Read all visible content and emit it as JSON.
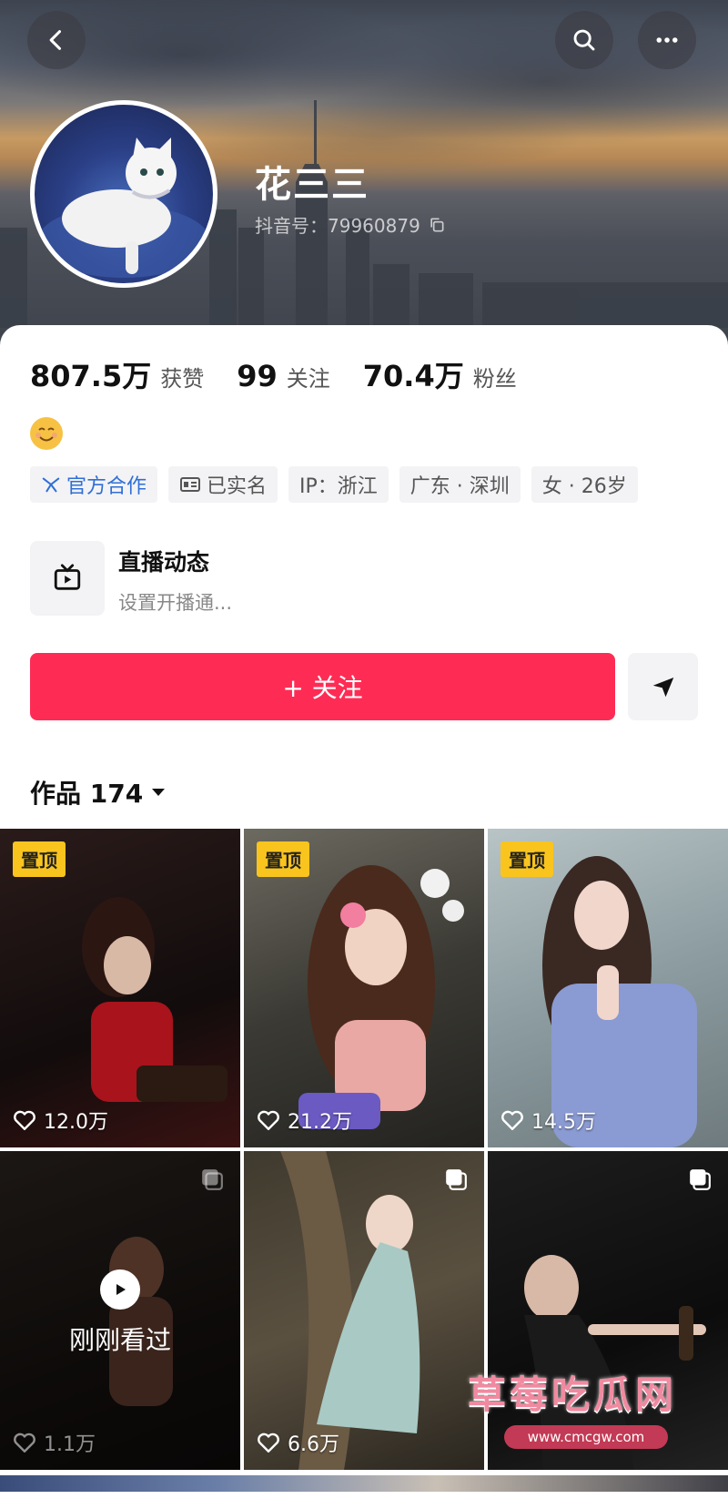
{
  "profile": {
    "name": "花三三",
    "douyin_id": "抖音号：79960879"
  },
  "stats": [
    {
      "value": "807.5万",
      "label": "获赞"
    },
    {
      "value": "99",
      "label": "关注"
    },
    {
      "value": "70.4万",
      "label": "粉丝"
    }
  ],
  "tags": {
    "official": "官方合作",
    "verified": "已实名",
    "ip": "IP：浙江",
    "location": "广东 · 深圳",
    "gender_age": "女 · 26岁"
  },
  "live": {
    "title": "直播动态",
    "subtitle": "设置开播通..."
  },
  "actions": {
    "follow": "+ 关注"
  },
  "works": {
    "label": "作品 174"
  },
  "videos": [
    {
      "pinned": "置顶",
      "likes": "12.0万"
    },
    {
      "pinned": "置顶",
      "likes": "21.2万"
    },
    {
      "pinned": "置顶",
      "likes": "14.5万"
    },
    {
      "watched": "刚刚看过",
      "likes": "1.1万"
    },
    {
      "likes": "6.6万"
    },
    {
      "likes": ""
    }
  ],
  "watermark": {
    "title": "草莓吃瓜网",
    "url": "www.cmcgw.com"
  },
  "colors": {
    "accent": "#fe2c55",
    "pin": "#f9c41e",
    "official": "#2f6fd6"
  }
}
